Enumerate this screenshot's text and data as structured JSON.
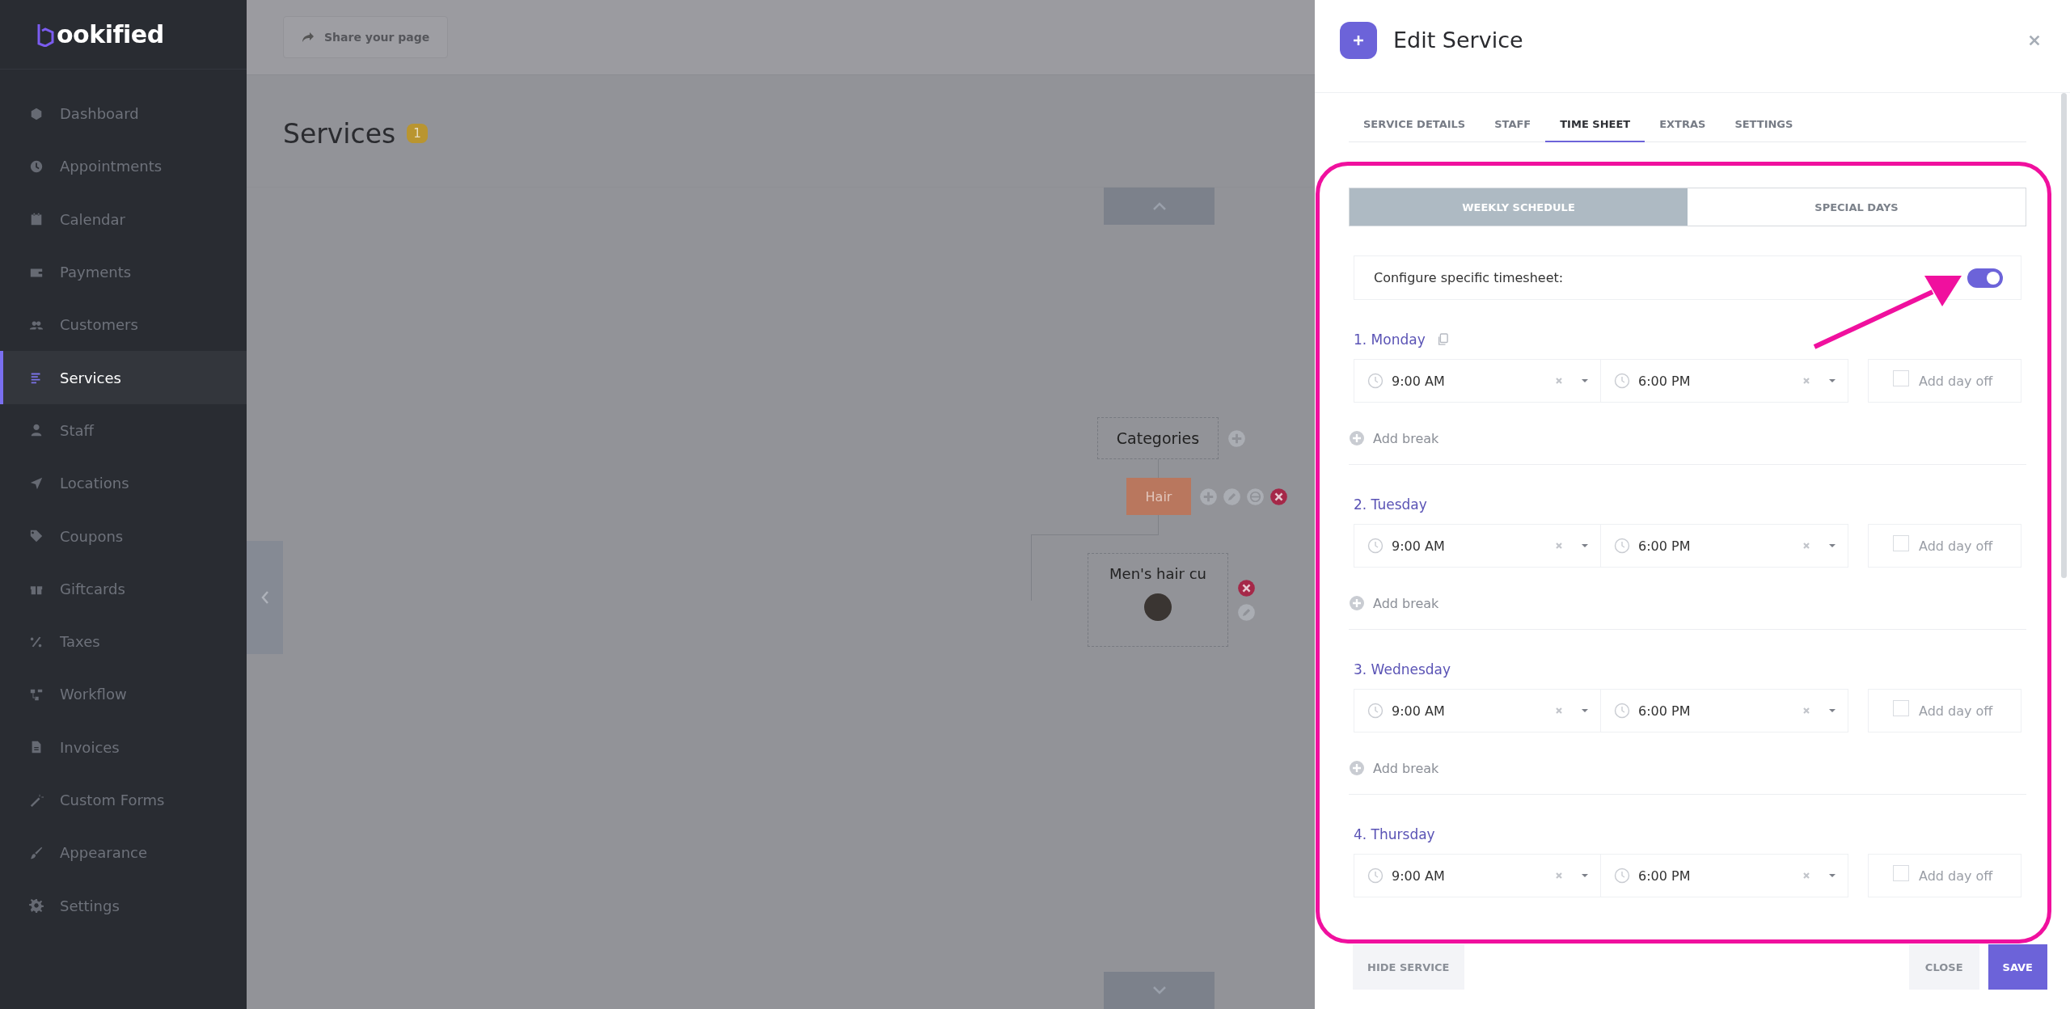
{
  "sidebar": {
    "logo": "ookified",
    "items": [
      {
        "label": "Dashboard",
        "selected": false
      },
      {
        "label": "Appointments",
        "selected": false
      },
      {
        "label": "Calendar",
        "selected": false
      },
      {
        "label": "Payments",
        "selected": false
      },
      {
        "label": "Customers",
        "selected": false
      },
      {
        "label": "Services",
        "selected": true
      },
      {
        "label": "Staff",
        "selected": false
      },
      {
        "label": "Locations",
        "selected": false
      },
      {
        "label": "Coupons",
        "selected": false
      },
      {
        "label": "Giftcards",
        "selected": false
      },
      {
        "label": "Taxes",
        "selected": false
      },
      {
        "label": "Workflow",
        "selected": false
      },
      {
        "label": "Invoices",
        "selected": false
      },
      {
        "label": "Custom Forms",
        "selected": false
      },
      {
        "label": "Appearance",
        "selected": false
      },
      {
        "label": "Settings",
        "selected": false
      }
    ]
  },
  "topbar": {
    "share_button": "Share your page"
  },
  "page": {
    "title": "Services",
    "count": "1"
  },
  "canvas": {
    "root": "Categories",
    "category": "Hair",
    "service": "Men's hair cu"
  },
  "panel": {
    "title": "Edit Service",
    "tabs": [
      {
        "label": "SERVICE DETAILS",
        "selected": false
      },
      {
        "label": "STAFF",
        "selected": false
      },
      {
        "label": "TIME SHEET",
        "selected": true
      },
      {
        "label": "EXTRAS",
        "selected": false
      },
      {
        "label": "SETTINGS",
        "selected": false
      }
    ],
    "subtabs": [
      {
        "label": "WEEKLY SCHEDULE",
        "selected": true
      },
      {
        "label": "SPECIAL DAYS",
        "selected": false
      }
    ],
    "toggle": {
      "label": "Configure specific timesheet:",
      "on": true
    },
    "days": [
      {
        "label": "1. Monday",
        "copy_icon": true,
        "start": "9:00 AM",
        "end": "6:00 PM",
        "day_off_label": "Add day off",
        "day_off": false,
        "add_break": "Add break"
      },
      {
        "label": "2. Tuesday",
        "copy_icon": false,
        "start": "9:00 AM",
        "end": "6:00 PM",
        "day_off_label": "Add day off",
        "day_off": false,
        "add_break": "Add break"
      },
      {
        "label": "3. Wednesday",
        "copy_icon": false,
        "start": "9:00 AM",
        "end": "6:00 PM",
        "day_off_label": "Add day off",
        "day_off": false,
        "add_break": "Add break"
      },
      {
        "label": "4. Thursday",
        "copy_icon": false,
        "start": "9:00 AM",
        "end": "6:00 PM",
        "day_off_label": "Add day off",
        "day_off": false
      }
    ],
    "footer": {
      "hide": "HIDE SERVICE",
      "close": "CLOSE",
      "save": "SAVE"
    }
  }
}
